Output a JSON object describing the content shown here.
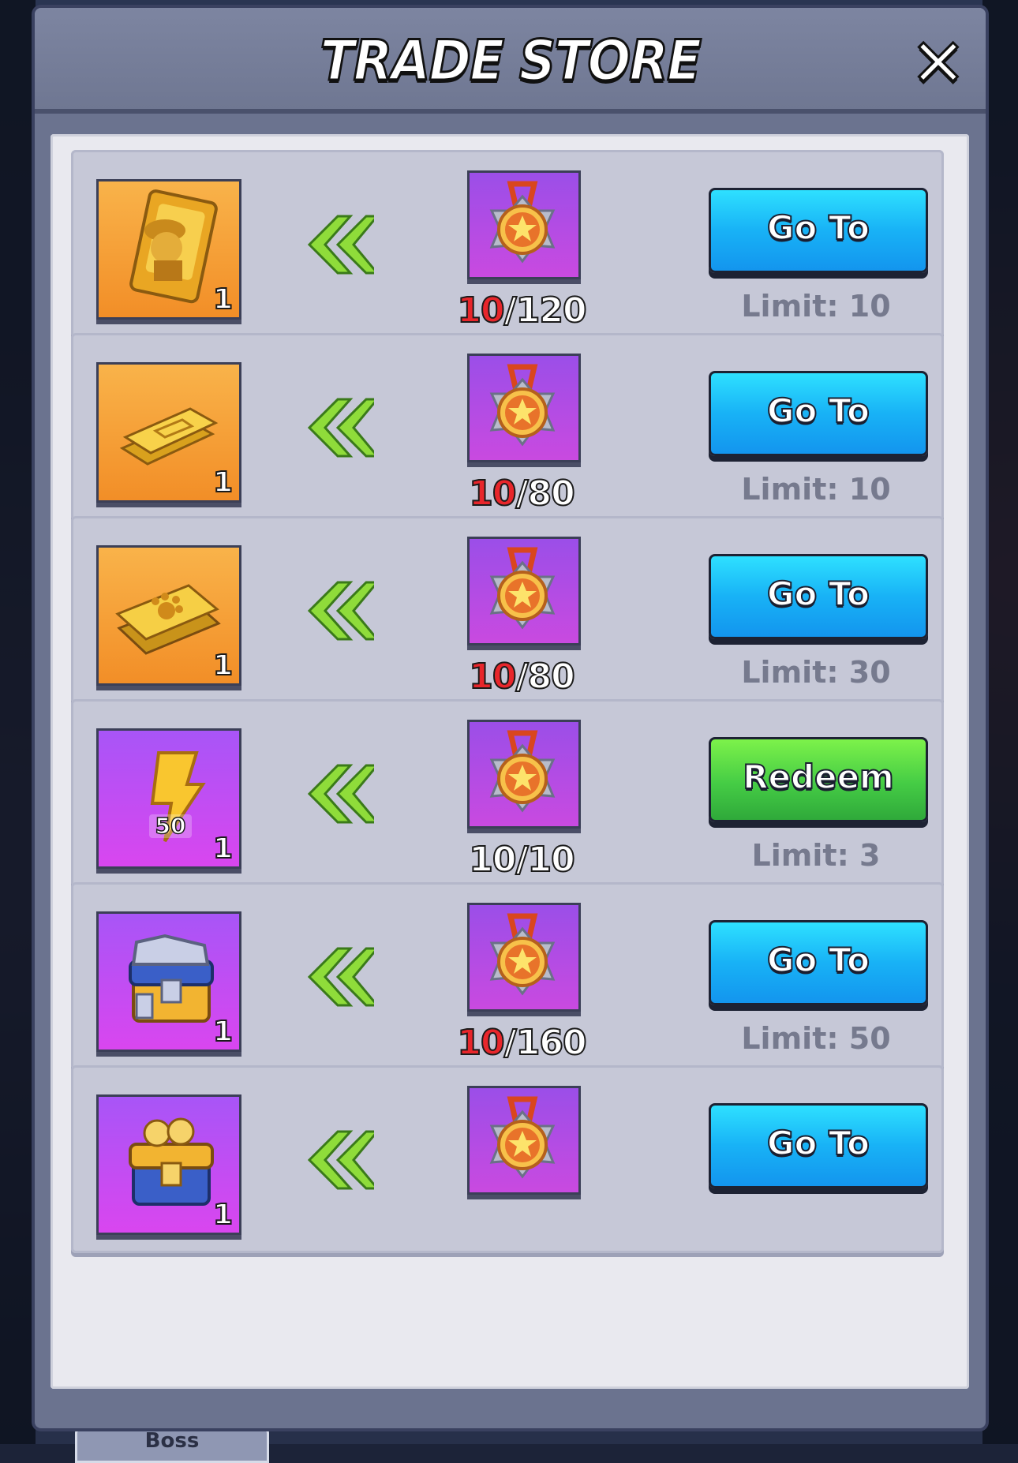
{
  "dialog": {
    "title": "TRADE STORE",
    "close_glyph": "✕"
  },
  "background": {
    "bottom_tab_label": "Boss"
  },
  "rows": [
    {
      "reward_icon": "golden-hero-card-icon",
      "reward_bg": "orange",
      "reward_qty": "1",
      "cost_icon": "star-medal-icon",
      "have": "10",
      "need": "/120",
      "button_label": "Go To",
      "button_style": "blue",
      "limit": "Limit: 10"
    },
    {
      "reward_icon": "gold-tickets-icon",
      "reward_bg": "orange",
      "reward_qty": "1",
      "cost_icon": "star-medal-icon",
      "have": "10",
      "need": "/80",
      "button_label": "Go To",
      "button_style": "blue",
      "limit": "Limit: 10"
    },
    {
      "reward_icon": "pet-card-icon",
      "reward_bg": "orange",
      "reward_qty": "1",
      "cost_icon": "star-medal-icon",
      "have": "10",
      "need": "/80",
      "button_label": "Go To",
      "button_style": "blue",
      "limit": "Limit: 30"
    },
    {
      "reward_icon": "energy-bolt-icon",
      "reward_bg": "purple",
      "reward_qty": "1",
      "reward_badge": "50",
      "cost_icon": "star-medal-icon",
      "have": "10/10",
      "need": "",
      "button_label": "Redeem",
      "button_style": "green",
      "limit": "Limit: 3"
    },
    {
      "reward_icon": "silver-chest-icon",
      "reward_bg": "purple",
      "reward_qty": "1",
      "cost_icon": "star-medal-icon",
      "have": "10",
      "need": "/160",
      "button_label": "Go To",
      "button_style": "blue",
      "limit": "Limit: 50"
    },
    {
      "reward_icon": "gold-chest-icon",
      "reward_bg": "purple",
      "reward_qty": "1",
      "cost_icon": "star-medal-icon",
      "have": "",
      "need": "",
      "button_label": "Go To",
      "button_style": "blue",
      "limit": ""
    }
  ],
  "colors": {
    "count_have": "#e8262b",
    "button_blue": "#18b2f6",
    "button_green": "#45cc45"
  }
}
